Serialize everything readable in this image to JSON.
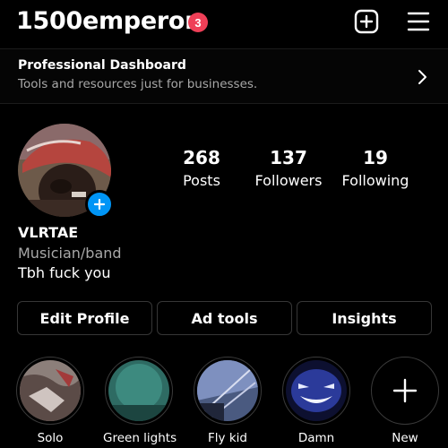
{
  "header": {
    "username": "1500emperor",
    "notification_count": "3"
  },
  "dashboard": {
    "title": "Professional Dashboard",
    "subtitle": "Tools and resources just for businesses."
  },
  "profile": {
    "stats": [
      {
        "value": "268",
        "label": "Posts"
      },
      {
        "value": "137",
        "label": "Followers"
      },
      {
        "value": "19",
        "label": "Following"
      }
    ],
    "display_name": "VLRTAE",
    "category": "Musician/band",
    "bio": "Tbh fuck you"
  },
  "actions": {
    "edit_profile": "Edit Profile",
    "ad_tools": "Ad tools",
    "insights": "Insights"
  },
  "highlights": [
    {
      "label": "Solo"
    },
    {
      "label": "Green lights"
    },
    {
      "label": "Fly kid"
    },
    {
      "label": "Damn"
    },
    {
      "label": "New"
    }
  ],
  "colors": {
    "background": "#000000",
    "badge": "#ef3f57",
    "accent": "#0095f6",
    "muted_text": "#a8a8a8"
  }
}
